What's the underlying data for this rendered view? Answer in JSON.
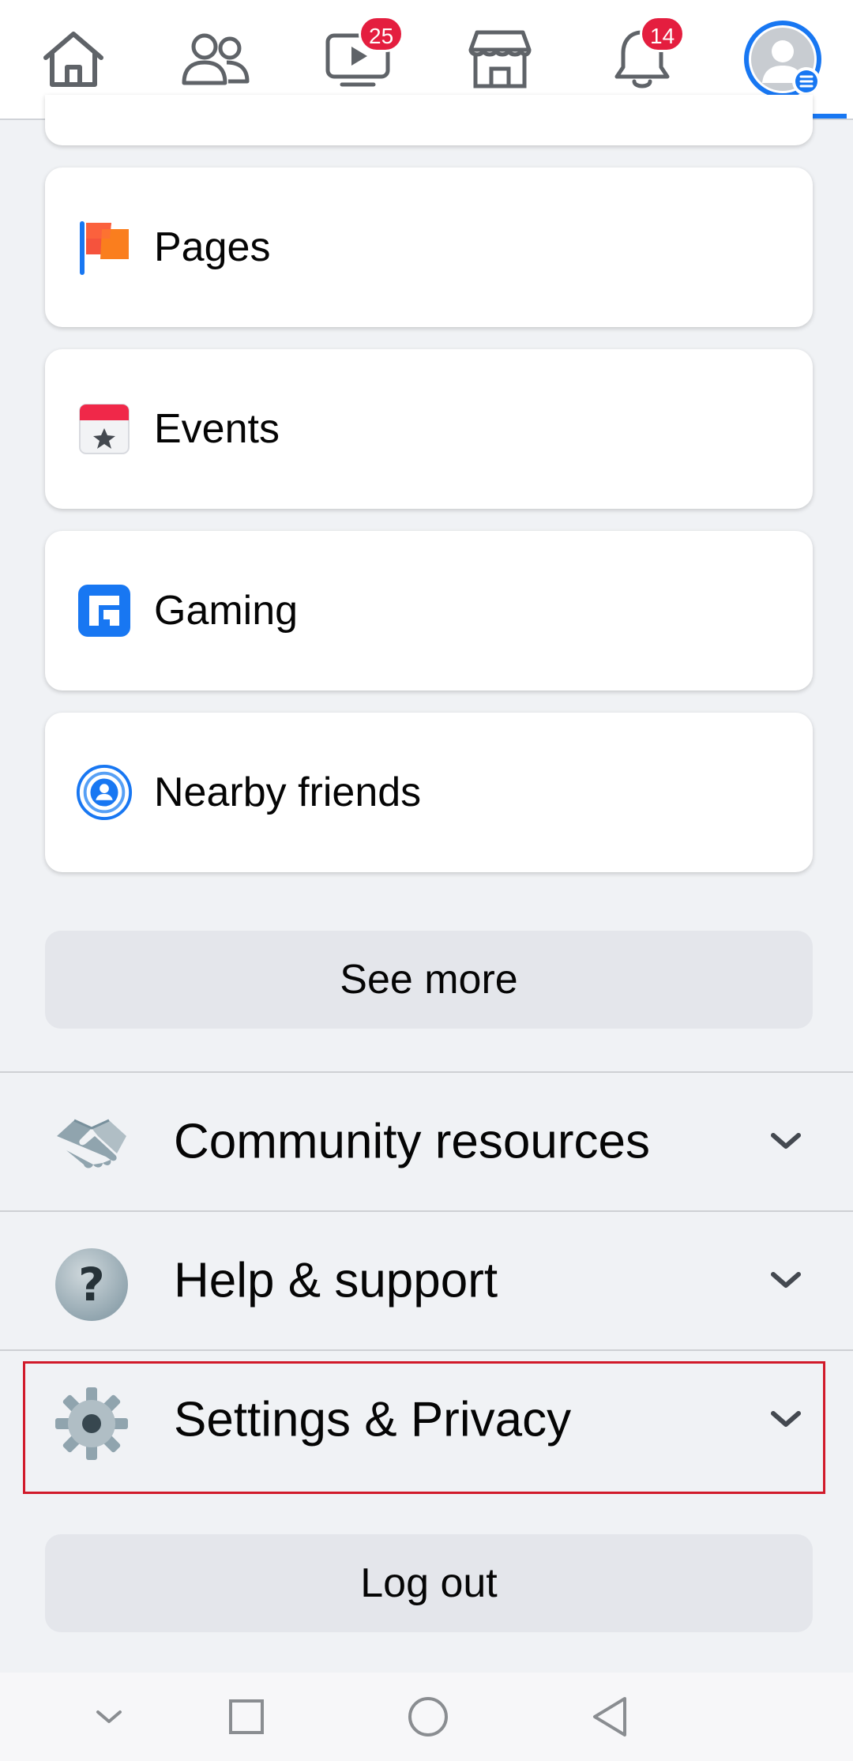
{
  "nav": {
    "tabs": [
      {
        "name": "home",
        "icon": "home-icon"
      },
      {
        "name": "friends",
        "icon": "friends-icon"
      },
      {
        "name": "watch",
        "icon": "watch-icon",
        "badge": "25"
      },
      {
        "name": "marketplace",
        "icon": "marketplace-icon"
      },
      {
        "name": "notifications",
        "icon": "bell-icon",
        "badge": "14"
      },
      {
        "name": "menu",
        "icon": "profile-menu-icon",
        "active": true
      }
    ],
    "accent_color": "#1877f2",
    "badge_color": "#e41e3f"
  },
  "shortcuts": [
    {
      "label": "Pages",
      "icon": "pages-flag-icon"
    },
    {
      "label": "Events",
      "icon": "events-calendar-icon"
    },
    {
      "label": "Gaming",
      "icon": "gaming-icon"
    },
    {
      "label": "Nearby friends",
      "icon": "nearby-friends-icon"
    }
  ],
  "see_more_label": "See more",
  "sections": [
    {
      "label": "Community resources",
      "icon": "handshake-icon"
    },
    {
      "label": "Help & support",
      "icon": "question-mark-icon"
    },
    {
      "label": "Settings & Privacy",
      "icon": "gear-icon"
    }
  ],
  "logout_label": "Log out",
  "system_nav": [
    "chevron-down-icon",
    "recents-square-icon",
    "home-circle-icon",
    "back-triangle-icon"
  ]
}
